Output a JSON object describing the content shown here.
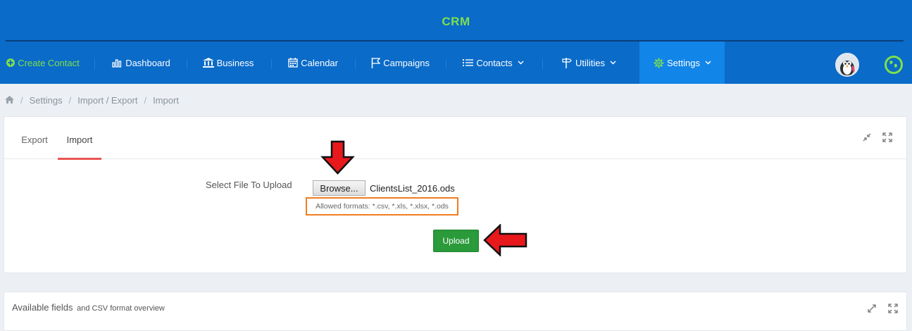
{
  "header": {
    "brand": "CRM"
  },
  "nav": {
    "create_contact": "Create Contact",
    "dashboard": "Dashboard",
    "business": "Business",
    "calendar": "Calendar",
    "campaigns": "Campaigns",
    "contacts": "Contacts",
    "utilities": "Utilities",
    "settings": "Settings"
  },
  "breadcrumb": [
    "Settings",
    "Import / Export",
    "Import"
  ],
  "tabs": {
    "export": "Export",
    "import": "Import"
  },
  "form": {
    "label": "Select File To Upload",
    "browse_label": "Browse...",
    "filename": "ClientsList_2016.ods",
    "formats": "Allowed formats: *.csv, *.xls, *.xlsx, *.ods",
    "upload_label": "Upload"
  },
  "available": {
    "title": "Available fields",
    "subtitle": "and CSV format overview"
  },
  "colors": {
    "header_bg": "#0a6bc9",
    "active_nav": "#1185e8",
    "brand_green": "#7ee04a",
    "upload_green": "#2a9a3a",
    "tab_accent": "#e95453",
    "annotation_orange": "#f07d21",
    "annotation_red": "#e8191c"
  },
  "icons": [
    "plus-circle-icon",
    "bar-chart-icon",
    "bank-icon",
    "calendar-icon",
    "flag-icon",
    "list-icon",
    "signpost-icon",
    "gear-icon",
    "chevron-down-icon",
    "home-icon",
    "compress-icon",
    "expand-icon",
    "avatar",
    "globe-icon"
  ]
}
